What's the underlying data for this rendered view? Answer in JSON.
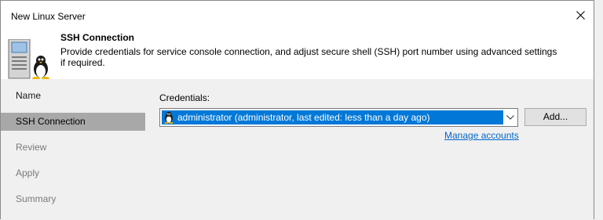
{
  "window": {
    "title": "New Linux Server"
  },
  "banner": {
    "title": "SSH Connection",
    "description": "Provide credentials for service console connection, and adjust secure shell (SSH) port number using advanced settings if required."
  },
  "nav": {
    "items": [
      {
        "label": "Name",
        "state": "done"
      },
      {
        "label": "SSH Connection",
        "state": "active"
      },
      {
        "label": "Review",
        "state": "pending"
      },
      {
        "label": "Apply",
        "state": "pending"
      },
      {
        "label": "Summary",
        "state": "pending"
      }
    ]
  },
  "credentials": {
    "label": "Credentials:",
    "selected": "administrator (administrator, last edited: less than a day ago)",
    "add_label": "Add...",
    "manage_link": "Manage accounts"
  },
  "colors": {
    "selection": "#0078d7",
    "link": "#0066cc",
    "nav_active": "#a8a8a8"
  }
}
